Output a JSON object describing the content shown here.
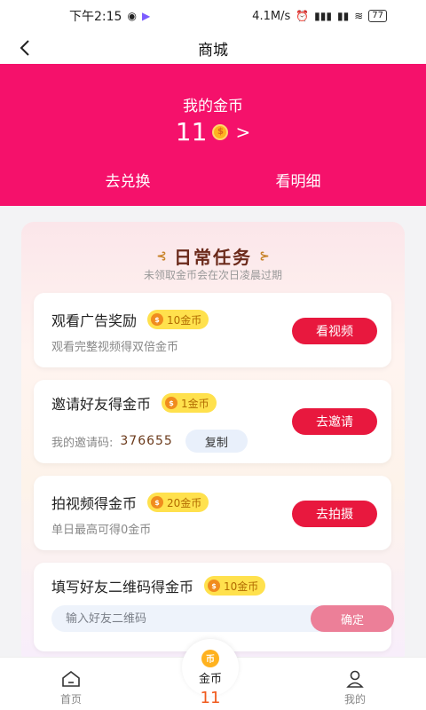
{
  "status_bar": {
    "time": "下午2:15",
    "speed": "4.1M/s",
    "battery": "77"
  },
  "nav": {
    "title": "商城"
  },
  "coins": {
    "label": "我的金币",
    "amount": "11",
    "coin_glyph": "$"
  },
  "header_actions": {
    "exchange": "去兑换",
    "details": "看明细"
  },
  "panel": {
    "title": "日常任务",
    "subtitle": "未领取金币会在次日凌晨过期"
  },
  "tasks": [
    {
      "title": "观看广告奖励",
      "reward": "10金币",
      "desc": "观看完整视频得双倍金币",
      "action": "看视频"
    },
    {
      "title": "邀请好友得金币",
      "reward": "1金币",
      "invite_label": "我的邀请码:",
      "invite_code": "376655",
      "copy": "复制",
      "action": "去邀请"
    },
    {
      "title": "拍视频得金币",
      "reward": "20金币",
      "desc": "单日最高可得0金币",
      "action": "去拍摄"
    },
    {
      "title": "填写好友二维码得金币",
      "reward": "10金币",
      "input_placeholder": "输入好友二维码",
      "confirm": "确定"
    }
  ],
  "tab_bar": {
    "home": "首页",
    "center_label": "金币",
    "center_amount": "11",
    "center_glyph": "币",
    "mine": "我的"
  },
  "colors": {
    "header": "#f5116b",
    "action_button": "#e8183e",
    "confirm_button": "#ec7f98",
    "reward_badge": "#ffe14d"
  },
  "icons": {
    "back": "chevron-left-icon",
    "coin": "coin-icon",
    "home": "home-icon",
    "mine": "user-icon"
  }
}
